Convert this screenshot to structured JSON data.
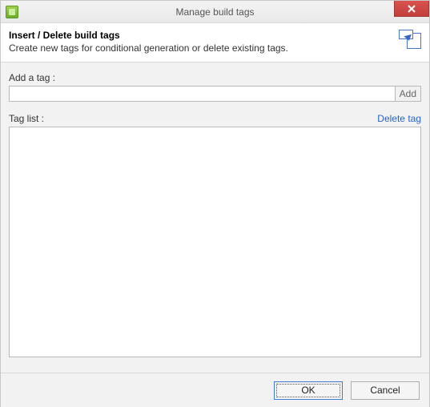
{
  "window": {
    "title": "Manage build tags"
  },
  "header": {
    "title": "Insert / Delete build tags",
    "subtitle": "Create new tags for conditional generation or delete existing tags."
  },
  "form": {
    "add_label": "Add a tag :",
    "add_value": "",
    "add_placeholder": "",
    "add_button": "Add",
    "taglist_label": "Tag list :",
    "delete_link": "Delete tag"
  },
  "footer": {
    "ok": "OK",
    "cancel": "Cancel"
  }
}
